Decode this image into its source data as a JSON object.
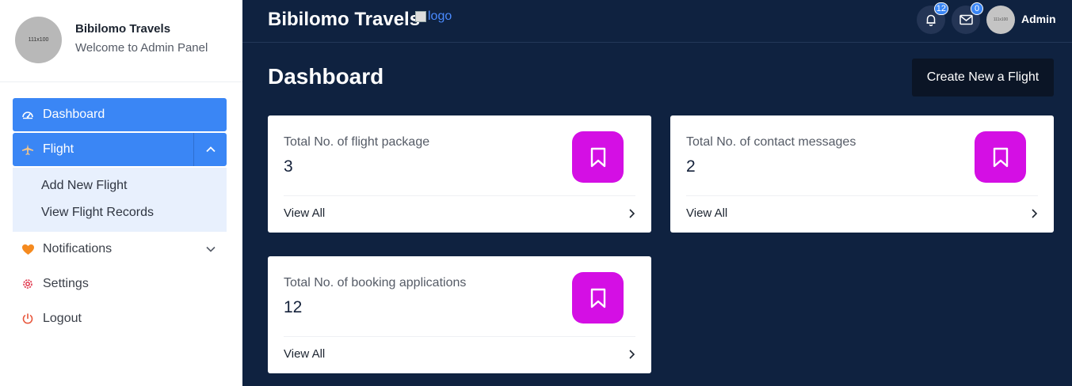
{
  "profile": {
    "avatar_text": "111x100",
    "name": "Bibilomo Travels",
    "subtitle": "Welcome to Admin Panel"
  },
  "sidebar": {
    "dashboard": "Dashboard",
    "flight": "Flight",
    "flight_sub": [
      "Add New Flight",
      "View Flight Records"
    ],
    "notifications": "Notifications",
    "settings": "Settings",
    "logout": "Logout"
  },
  "topbar": {
    "brand": "Bibilomo Travels",
    "logo_alt": "logo",
    "bell_count": "12",
    "mail_count": "0",
    "admin_avatar_text": "111x100",
    "admin_name": "Admin"
  },
  "main": {
    "title": "Dashboard",
    "create_button": "Create New a Flight",
    "cards": [
      {
        "label": "Total No. of flight package",
        "value": "3",
        "link": "View All"
      },
      {
        "label": "Total No. of contact messages",
        "value": "2",
        "link": "View All"
      },
      {
        "label": "Total No. of booking applications",
        "value": "12",
        "link": "View All"
      }
    ]
  },
  "colors": {
    "background": "#0f2240",
    "sidebar_active": "#3a86f5",
    "card_icon": "#d40fe4",
    "notifications_icon": "#f58a1f",
    "settings_icon": "#e0344a",
    "logout_icon": "#e8553a"
  },
  "icons": {
    "dashboard": "gauge-icon",
    "flight": "plane-icon",
    "notifications": "heart-icon",
    "settings": "gear-icon",
    "logout": "power-icon",
    "card": "bookmark-icon"
  }
}
